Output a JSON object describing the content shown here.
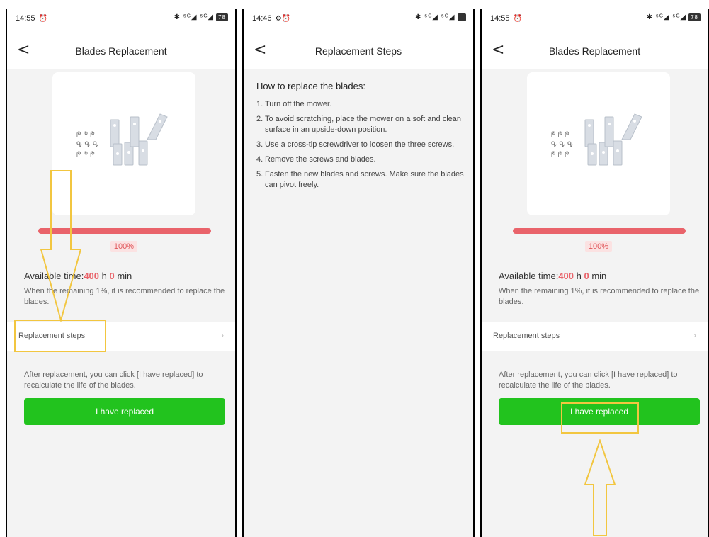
{
  "colors": {
    "accent_green": "#22c31e",
    "progress_red": "#e9636a",
    "badge_bg": "#fbe2e2",
    "highlight_yellow": "#f2c640"
  },
  "screens": [
    {
      "status": {
        "time": "14:55",
        "alarm_icon": "alarm-clock-icon",
        "signal": "✱ ⁵ᴳ◢ ⁵ᴳ◢",
        "battery": "78"
      },
      "nav": {
        "back_icon": "back-chevron-icon",
        "title": "Blades Replacement"
      },
      "image": {
        "alt_icon": "blades-and-screws-illustration"
      },
      "progress": {
        "value": 1.0,
        "label": "100%"
      },
      "available": {
        "prefix": "Available time:",
        "hours": "400",
        "h_unit": " h ",
        "minutes": "0",
        "m_unit": " min"
      },
      "note": "When the remaining 1%, it is recommended to replace the blades.",
      "steps_row": {
        "label": "Replacement steps",
        "chevron": "›"
      },
      "after_note": "After replacement, you can click [I have replaced] to recalculate the life of the blades.",
      "button": "I have replaced"
    },
    {
      "status": {
        "time": "14:46",
        "alarm_icon": "alarm-clock-icon",
        "signal": "✱ ⁵ᴳ◢ ⁵ᴳ◢",
        "battery": ""
      },
      "nav": {
        "back_icon": "back-chevron-icon",
        "title": "Replacement Steps"
      },
      "howto_title": "How to replace the blades:",
      "steps": [
        {
          "n": "1.",
          "text": "Turn off the mower."
        },
        {
          "n": "2.",
          "text": "To avoid scratching, place the mower on a soft and clean surface in an upside-down position."
        },
        {
          "n": "3.",
          "text": "Use a cross-tip screwdriver to loosen the three screws."
        },
        {
          "n": "4.",
          "text": "Remove the screws and blades."
        },
        {
          "n": "5.",
          "text": "Fasten the new blades and screws. Make sure the blades can pivot freely."
        }
      ]
    },
    {
      "status": {
        "time": "14:55",
        "alarm_icon": "alarm-clock-icon",
        "signal": "✱ ⁵ᴳ◢ ⁵ᴳ◢",
        "battery": "78"
      },
      "nav": {
        "back_icon": "back-chevron-icon",
        "title": "Blades Replacement"
      },
      "image": {
        "alt_icon": "blades-and-screws-illustration"
      },
      "progress": {
        "value": 1.0,
        "label": "100%"
      },
      "available": {
        "prefix": "Available time:",
        "hours": "400",
        "h_unit": " h ",
        "minutes": "0",
        "m_unit": " min"
      },
      "note": "When the remaining 1%, it is recommended to replace the blades.",
      "steps_row": {
        "label": "Replacement steps",
        "chevron": "›"
      },
      "after_note": "After replacement, you can click [I have replaced] to recalculate the life of the blades.",
      "button": "I have replaced"
    }
  ]
}
